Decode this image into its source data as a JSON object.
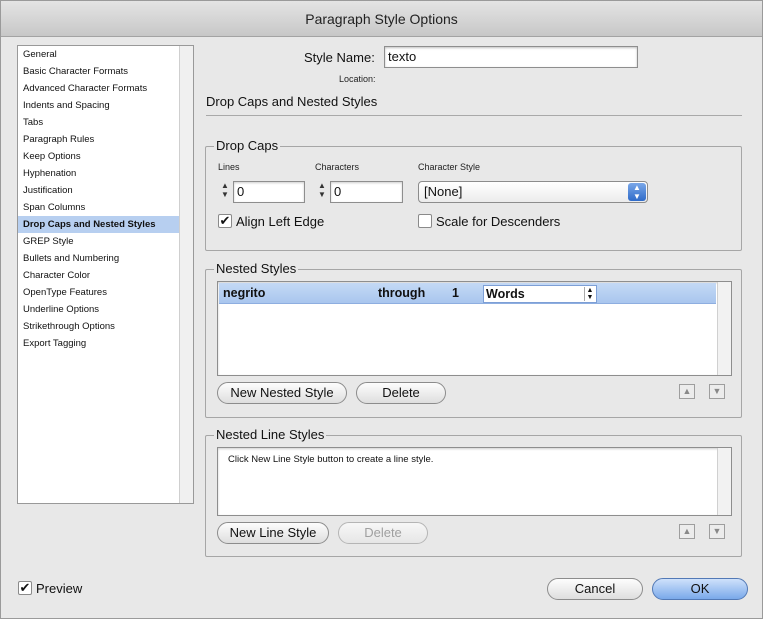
{
  "window": {
    "title": "Paragraph Style Options"
  },
  "sidebar": {
    "items": [
      {
        "label": "General"
      },
      {
        "label": "Basic Character Formats"
      },
      {
        "label": "Advanced Character Formats"
      },
      {
        "label": "Indents and Spacing"
      },
      {
        "label": "Tabs"
      },
      {
        "label": "Paragraph Rules"
      },
      {
        "label": "Keep Options"
      },
      {
        "label": "Hyphenation"
      },
      {
        "label": "Justification"
      },
      {
        "label": "Span Columns"
      },
      {
        "label": "Drop Caps and Nested Styles",
        "selected": true
      },
      {
        "label": "GREP Style"
      },
      {
        "label": "Bullets and Numbering"
      },
      {
        "label": "Character Color"
      },
      {
        "label": "OpenType Features"
      },
      {
        "label": "Underline Options"
      },
      {
        "label": "Strikethrough Options"
      },
      {
        "label": "Export Tagging"
      }
    ]
  },
  "header": {
    "style_name_label": "Style Name:",
    "style_name_value": "texto",
    "location_label": "Location:",
    "section_title": "Drop Caps and Nested Styles"
  },
  "drop_caps": {
    "title": "Drop Caps",
    "lines_label": "Lines",
    "lines_value": "0",
    "characters_label": "Characters",
    "characters_value": "0",
    "char_style_label": "Character Style",
    "char_style_value": "[None]",
    "align_left_edge_label": "Align Left Edge",
    "align_left_edge_checked": true,
    "scale_descenders_label": "Scale for Descenders",
    "scale_descenders_checked": false,
    "check_glyph": "✔"
  },
  "nested_styles": {
    "title": "Nested Styles",
    "rows": [
      {
        "style": "negrito",
        "mode": "through",
        "count": "1",
        "unit": "Words"
      }
    ],
    "new_button": "New Nested Style",
    "delete_button": "Delete"
  },
  "nested_line_styles": {
    "title": "Nested Line Styles",
    "hint": "Click New Line Style button to create a line style.",
    "new_button": "New Line Style",
    "delete_button": "Delete"
  },
  "footer": {
    "preview_label": "Preview",
    "preview_checked": true,
    "cancel_button": "Cancel",
    "ok_button": "OK"
  },
  "colors": {
    "selection": "#b7cff0",
    "row_highlight": "#b3cdf1",
    "accent_blue": "#2f6bc9"
  },
  "icons": {
    "spinner": "stepper-arrows-icon",
    "move_up": "triangle-up-icon",
    "move_down": "triangle-down-icon"
  }
}
